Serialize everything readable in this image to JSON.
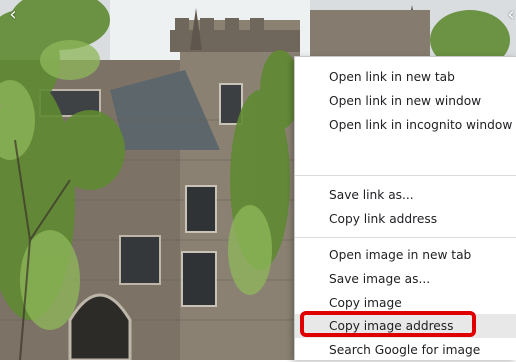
{
  "context_menu": {
    "items": [
      {
        "label": "Open link in new tab"
      },
      {
        "label": "Open link in new window"
      },
      {
        "label": "Open link in incognito window"
      },
      {
        "label": ""
      },
      {
        "label": "Save link as..."
      },
      {
        "label": "Copy link address"
      },
      {
        "label": "Open image in new tab"
      },
      {
        "label": "Save image as..."
      },
      {
        "label": "Copy image"
      },
      {
        "label": "Copy image address"
      },
      {
        "label": "Search Google for image"
      }
    ],
    "highlighted_item": "Copy image address"
  },
  "nav": {
    "prev_icon": "‹",
    "next_icon": "‹"
  },
  "colors": {
    "annotation": "#e10000",
    "menu_background": "#ffffff",
    "menu_hover": "#e8e8e8"
  }
}
